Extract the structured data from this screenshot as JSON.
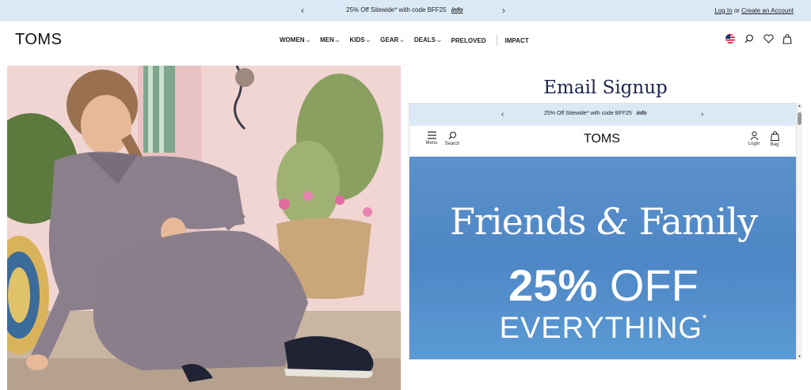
{
  "promo": {
    "prev_label": "‹",
    "next_label": "›",
    "message": "25% Off Sitewide* with code BFF25",
    "info_link": "info",
    "login": "Log In",
    "or": "or",
    "create_account": "Create an Account"
  },
  "header": {
    "logo": "TOMS",
    "nav": [
      {
        "label": "WOMEN"
      },
      {
        "label": "MEN"
      },
      {
        "label": "KIDS"
      },
      {
        "label": "GEAR"
      },
      {
        "label": "DEALS"
      },
      {
        "label": "PRELOVED"
      },
      {
        "label": "IMPACT"
      }
    ],
    "icons": [
      "us-flag-icon",
      "search-icon",
      "heart-icon",
      "bag-icon"
    ]
  },
  "right_panel": {
    "title": "Email Signup",
    "embedded": {
      "promo_message": "25% Off Sitewide* with code BFF25",
      "promo_info": "info",
      "logo": "TOMS",
      "menu_label": "Menu",
      "search_label": "Search",
      "login_label": "Login",
      "bag_label": "Bag",
      "banner": {
        "line1_a": "Friends",
        "line1_amp": "&",
        "line1_b": "Family",
        "line2_bold": "25%",
        "line2_rest": "OFF",
        "line3": "EVERYTHING",
        "line3_mark": "*"
      }
    }
  },
  "colors": {
    "promo_bg": "#dbe9f7",
    "banner_blue": "#4e86c5",
    "title_navy": "#1d2450"
  }
}
